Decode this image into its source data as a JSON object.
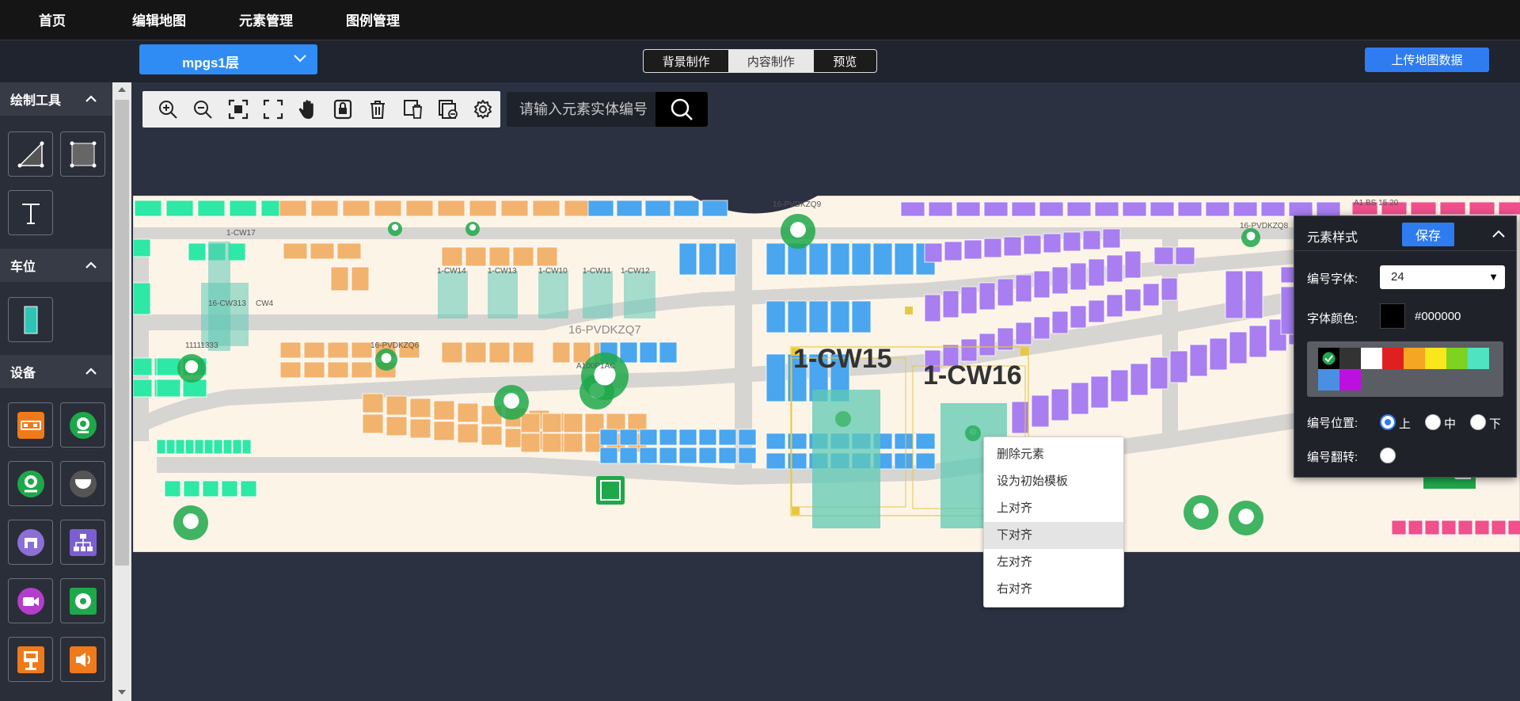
{
  "nav": {
    "home": "首页",
    "edit_map": "编辑地图",
    "element_mgmt": "元素管理",
    "legend_mgmt": "图例管理"
  },
  "floor_select": {
    "value": "mpgs1层"
  },
  "mode_tabs": [
    "背景制作",
    "内容制作",
    "预览"
  ],
  "mode_active": "内容制作",
  "upload_button": "上传地图数据",
  "sidebar": {
    "draw_tools": {
      "title": "绘制工具"
    },
    "parking": {
      "title": "车位"
    },
    "device": {
      "title": "设备"
    }
  },
  "search": {
    "placeholder": "请输入元素实体编号"
  },
  "map": {
    "labels": [
      "1-CW17",
      "16-CW313",
      "CW4",
      "11111333",
      "1-CW14",
      "1-CW13",
      "1-CW10",
      "1-CW11",
      "1-CW12",
      "16-PVDKZQ7",
      "A100P1AC",
      "16-PVDKZQ9",
      "A1 BS 15 20",
      "16-PVDKZQ6",
      "16-PVDKZQ8"
    ],
    "big_labels": [
      "1-CW15",
      "1-CW16"
    ]
  },
  "context_menu": {
    "items": [
      "删除元素",
      "设为初始模板",
      "上对齐",
      "下对齐",
      "左对齐",
      "右对齐"
    ],
    "highlighted": "下对齐"
  },
  "style_panel": {
    "title": "元素样式",
    "save": "保存",
    "font_label": "编号字体:",
    "font_value": "24",
    "color_label": "字体颜色:",
    "color_value": "#000000",
    "swatches": [
      "#000000",
      "#333333",
      "#ffffff",
      "#e02020",
      "#f5a623",
      "#f8e71c",
      "#7ed321",
      "#50e3c2",
      "#4a90e2",
      "#bd10e0"
    ],
    "position_label": "编号位置:",
    "position_options": [
      "上",
      "中",
      "下"
    ],
    "position_selected": "上",
    "flip_label": "编号翻转:"
  },
  "colors": {
    "accent": "#2f7cf0",
    "parking_teal": "#2ee8a5",
    "parking_orange": "#f2b36e",
    "parking_blue": "#4aa6ee",
    "parking_purple": "#a87ef0",
    "parking_pink": "#f0508c",
    "selection": "#e8c840"
  }
}
